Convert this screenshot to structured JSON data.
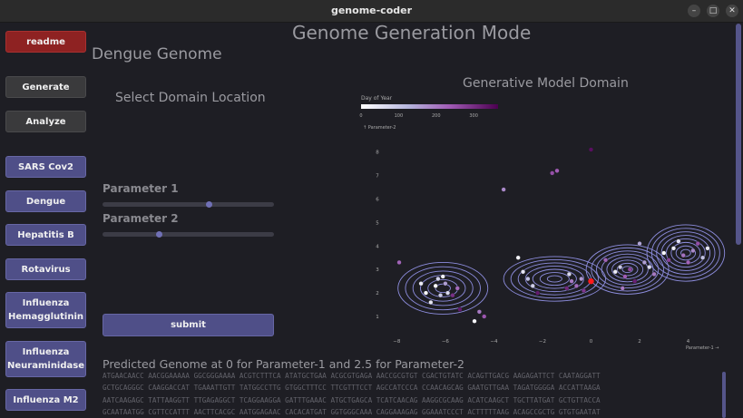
{
  "window": {
    "title": "genome-coder"
  },
  "sidebar": {
    "readme": "readme",
    "generate": "Generate",
    "analyze": "Analyze",
    "viruses": [
      "SARS Cov2",
      "Dengue",
      "Hepatitis B",
      "Rotavirus",
      "Influenza Hemagglutinin",
      "Influenza Neuraminidase",
      "Influenza M2"
    ]
  },
  "main": {
    "title": "Genome Generation Mode",
    "subtitle": "Dengue Genome",
    "select_heading": "Select Domain Location",
    "param1_label": "Parameter 1",
    "param2_label": "Parameter 2",
    "param1_value": 0.62,
    "param2_value": 0.33,
    "submit": "submit",
    "predicted_heading": "Predicted Genome at 0 for Parameter-1 and 2.5 for Parameter-2",
    "sequence_lines": [
      "ATGAACAACC  AACGGAAAAA  GGCGGGAAAA  ACGTCTTTCA  ATATGCTGAA  ACGCGTGAGA  AACCGCGTGT  CGACTGTATC  ACAGTTGACG  AAGAGATTCT  CAATAGGATT",
      "GCTGCAGGGC  CAAGGACCAT  TGAAATTGTT  TATGGCCTTG  GTGGCTTTCC  TTCGTTTCCT  AGCCATCCCA  CCAACAGCAG  GAATGTTGAA  TAGATGGGGA  ACCATTAAGA",
      "AATCAAGAGC  TATTAAGGTT  TTGAGAGGCT  TCAGGAAGGA  GATTTGAAAC  ATGCTGAGCA  TCATCAACAG  AAGGCGCAAG  ACATCAAGCT  TGCTTATGAT  GCTGTTACCA",
      "GCAATAATGG  CGTTCCATTT  AACTTCACGC  AATGGAGAAC  CACACATGAT  GGTGGGCAAA  CAGGAAAGAG  GGAAATCCCT  ACTTTTTAAG  ACAGCCGCTG  GTGTGAATAT"
    ]
  },
  "plot": {
    "title": "Generative Model Domain",
    "colorbar_title": "Day of Year",
    "colorbar_ticks": [
      "0",
      "100",
      "200",
      "300"
    ],
    "y_axis_label": "↑ Parameter-2",
    "x_axis_label": "Parameter-1 →",
    "x_ticks": [
      "−8",
      "−6",
      "−4",
      "−2",
      "0",
      "2",
      "4"
    ],
    "y_ticks": [
      "1",
      "2",
      "3",
      "4",
      "5",
      "6",
      "7",
      "8"
    ],
    "xlim": [
      -8.2,
      5.1
    ],
    "ylim": [
      0.5,
      8.6
    ],
    "selected_point": {
      "x": 0,
      "y": 2.5
    },
    "points": [
      {
        "x": -6.1,
        "y": 2.7,
        "v": 20
      },
      {
        "x": -6.4,
        "y": 2.3,
        "v": 5
      },
      {
        "x": -5.9,
        "y": 2.0,
        "v": 60
      },
      {
        "x": -5.5,
        "y": 2.2,
        "v": 220
      },
      {
        "x": -6.8,
        "y": 2.0,
        "v": 10
      },
      {
        "x": -6.6,
        "y": 1.6,
        "v": 40
      },
      {
        "x": -6.2,
        "y": 1.9,
        "v": 90
      },
      {
        "x": -6.0,
        "y": 2.4,
        "v": 150
      },
      {
        "x": -5.7,
        "y": 1.9,
        "v": 300
      },
      {
        "x": -7.0,
        "y": 2.4,
        "v": 30
      },
      {
        "x": -6.3,
        "y": 2.6,
        "v": 70
      },
      {
        "x": -5.4,
        "y": 1.3,
        "v": 330
      },
      {
        "x": -4.8,
        "y": 0.8,
        "v": 15
      },
      {
        "x": -4.4,
        "y": 1.0,
        "v": 250
      },
      {
        "x": -4.6,
        "y": 1.2,
        "v": 200
      },
      {
        "x": -7.9,
        "y": 3.3,
        "v": 230
      },
      {
        "x": -3.6,
        "y": 6.4,
        "v": 180
      },
      {
        "x": -1.6,
        "y": 7.1,
        "v": 260
      },
      {
        "x": -1.4,
        "y": 7.2,
        "v": 240
      },
      {
        "x": 0.0,
        "y": 8.1,
        "v": 345
      },
      {
        "x": -3.0,
        "y": 3.5,
        "v": 20
      },
      {
        "x": -2.8,
        "y": 2.9,
        "v": 40
      },
      {
        "x": -2.6,
        "y": 2.6,
        "v": 100
      },
      {
        "x": -2.4,
        "y": 2.3,
        "v": 80
      },
      {
        "x": -0.8,
        "y": 2.5,
        "v": 200
      },
      {
        "x": -0.6,
        "y": 2.3,
        "v": 220
      },
      {
        "x": -1.0,
        "y": 2.2,
        "v": 310
      },
      {
        "x": -0.4,
        "y": 2.6,
        "v": 160
      },
      {
        "x": -0.9,
        "y": 2.8,
        "v": 60
      },
      {
        "x": -0.3,
        "y": 2.1,
        "v": 290
      },
      {
        "x": 1.0,
        "y": 2.9,
        "v": 30
      },
      {
        "x": 1.2,
        "y": 3.1,
        "v": 90
      },
      {
        "x": 1.4,
        "y": 2.7,
        "v": 240
      },
      {
        "x": 1.6,
        "y": 3.0,
        "v": 270
      },
      {
        "x": 1.8,
        "y": 2.5,
        "v": 320
      },
      {
        "x": 2.2,
        "y": 3.3,
        "v": 150
      },
      {
        "x": 2.4,
        "y": 3.1,
        "v": 60
      },
      {
        "x": 2.6,
        "y": 2.8,
        "v": 200
      },
      {
        "x": 3.0,
        "y": 3.7,
        "v": 10
      },
      {
        "x": 3.4,
        "y": 3.9,
        "v": 30
      },
      {
        "x": 3.6,
        "y": 4.2,
        "v": 50
      },
      {
        "x": 3.8,
        "y": 3.6,
        "v": 210
      },
      {
        "x": 4.0,
        "y": 3.3,
        "v": 230
      },
      {
        "x": 4.2,
        "y": 3.8,
        "v": 180
      },
      {
        "x": 4.4,
        "y": 4.1,
        "v": 260
      },
      {
        "x": 4.6,
        "y": 3.5,
        "v": 100
      },
      {
        "x": 4.8,
        "y": 3.9,
        "v": 40
      },
      {
        "x": 3.2,
        "y": 3.4,
        "v": 280
      },
      {
        "x": 2.0,
        "y": 4.1,
        "v": 140
      },
      {
        "x": 0.6,
        "y": 3.4,
        "v": 230
      },
      {
        "x": 1.3,
        "y": 2.2,
        "v": 200
      },
      {
        "x": -2.2,
        "y": 2.0,
        "v": 330
      }
    ]
  },
  "colors": {
    "accent": "#4f4f88",
    "readme": "#8e2222",
    "selected": "#ff1a1a",
    "contour": "#8d8dde"
  }
}
